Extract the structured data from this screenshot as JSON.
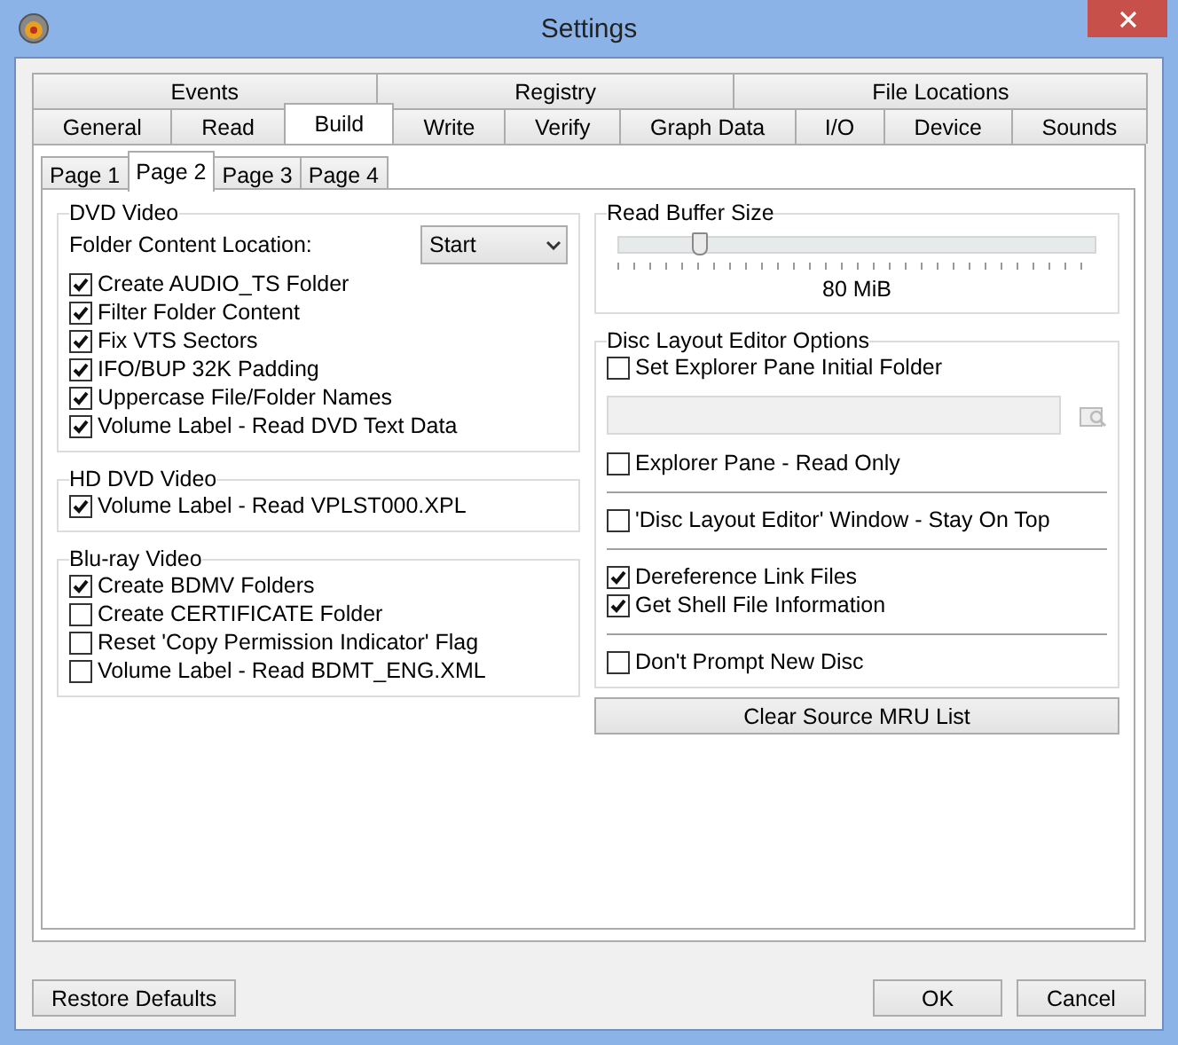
{
  "window": {
    "title": "Settings"
  },
  "tab_rows": [
    [
      {
        "label": "Events",
        "selected": false
      },
      {
        "label": "Registry",
        "selected": false
      },
      {
        "label": "File Locations",
        "selected": false
      }
    ],
    [
      {
        "label": "General",
        "selected": false
      },
      {
        "label": "Read",
        "selected": false
      },
      {
        "label": "Build",
        "selected": true
      },
      {
        "label": "Write",
        "selected": false
      },
      {
        "label": "Verify",
        "selected": false
      },
      {
        "label": "Graph Data",
        "selected": false
      },
      {
        "label": "I/O",
        "selected": false
      },
      {
        "label": "Device",
        "selected": false
      },
      {
        "label": "Sounds",
        "selected": false
      }
    ]
  ],
  "subtabs": [
    {
      "label": "Page 1",
      "selected": false
    },
    {
      "label": "Page 2",
      "selected": true
    },
    {
      "label": "Page 3",
      "selected": false
    },
    {
      "label": "Page 4",
      "selected": false
    }
  ],
  "left_groups": [
    {
      "title": "DVD Video",
      "dropdown": {
        "label": "Folder Content Location:",
        "value": "Start"
      },
      "options": [
        {
          "label": "Create AUDIO_TS Folder",
          "checked": true
        },
        {
          "label": "Filter Folder Content",
          "checked": true
        },
        {
          "label": "Fix VTS Sectors",
          "checked": true
        },
        {
          "label": "IFO/BUP 32K Padding",
          "checked": true
        },
        {
          "label": "Uppercase File/Folder Names",
          "checked": true
        },
        {
          "label": "Volume Label - Read DVD Text Data",
          "checked": true
        }
      ]
    },
    {
      "title": "HD DVD Video",
      "options": [
        {
          "label": "Volume Label - Read VPLST000.XPL",
          "checked": true
        }
      ]
    },
    {
      "title": "Blu-ray Video",
      "options": [
        {
          "label": "Create BDMV Folders",
          "checked": true
        },
        {
          "label": "Create CERTIFICATE Folder",
          "checked": false
        },
        {
          "label": "Reset 'Copy Permission Indicator' Flag",
          "checked": false
        },
        {
          "label": "Volume Label - Read BDMT_ENG.XML",
          "checked": false
        }
      ]
    }
  ],
  "read_buffer": {
    "title": "Read Buffer Size",
    "level": 0.17,
    "reading": "80 MiB"
  },
  "disc_layout": {
    "title": "Disc Layout Editor Options",
    "sections": [
      [
        {
          "kind": "checkbox",
          "label": "Set Explorer Pane Initial Folder",
          "checked": false
        },
        {
          "kind": "path_field"
        },
        {
          "kind": "checkbox",
          "label": "Explorer Pane - Read Only",
          "checked": false
        }
      ],
      [
        {
          "kind": "checkbox",
          "label": "'Disc Layout Editor' Window - Stay On Top",
          "checked": false
        }
      ],
      [
        {
          "kind": "checkbox",
          "label": "Dereference Link Files",
          "checked": true
        },
        {
          "kind": "checkbox",
          "label": "Get Shell File Information",
          "checked": true
        }
      ],
      [
        {
          "kind": "checkbox",
          "label": "Don't Prompt New Disc",
          "checked": false
        }
      ]
    ]
  },
  "clear_button": "Clear Source MRU List",
  "buttons": {
    "restore": "Restore Defaults",
    "ok": "OK",
    "cancel": "Cancel"
  }
}
